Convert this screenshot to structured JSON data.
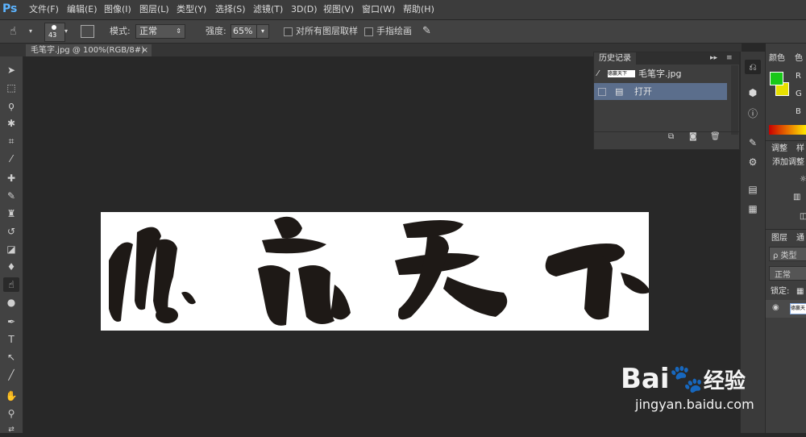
{
  "app": {
    "logo": "Ps"
  },
  "menu": [
    "文件(F)",
    "编辑(E)",
    "图像(I)",
    "图层(L)",
    "类型(Y)",
    "选择(S)",
    "滤镜(T)",
    "3D(D)",
    "视图(V)",
    "窗口(W)",
    "帮助(H)"
  ],
  "options": {
    "brush_size": "43",
    "mode_label": "模式:",
    "mode_value": "正常",
    "strength_label": "强度:",
    "strength_value": "65%",
    "sample_all_layers": "对所有图层取样",
    "finger_paint": "手指绘画"
  },
  "document": {
    "tab_title": "毛笔字.jpg @ 100%(RGB/8#)",
    "close_glyph": "×",
    "canvas_text": "德 赢 天 下"
  },
  "history": {
    "title": "历史记录",
    "snapshot_name": "毛笔字.jpg",
    "thumb_text": "德赢天下",
    "steps": [
      {
        "label": "打开"
      }
    ]
  },
  "right_panels": {
    "color_tab": "颜色",
    "color_tab2": "色",
    "r": "R",
    "g": "G",
    "b": "B",
    "adjust_tab": "调整",
    "adjust_tab2": "样",
    "add_adjust": "添加调整",
    "layers_tab": "图层",
    "layers_tab2": "通",
    "kind_label": "ρ 类型",
    "blend_mode": "正常",
    "lock_label": "锁定:",
    "layer_thumb": "德赢天下"
  },
  "colors": {
    "foreground": "#18c818",
    "background": "#e8e000",
    "accent": "#5cb4ff",
    "history_selected": "#5b6e8c"
  },
  "watermark": {
    "brand": "Bai",
    "brand2": "经验",
    "url": "jingyan.baidu.com"
  }
}
